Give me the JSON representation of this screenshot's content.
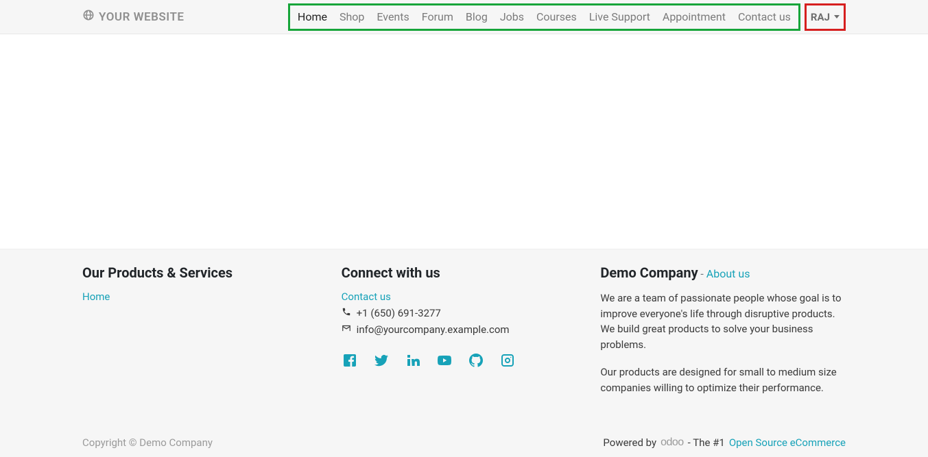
{
  "brand": {
    "name": "YOUR WEBSITE"
  },
  "nav": {
    "items": [
      {
        "label": "Home",
        "active": true
      },
      {
        "label": "Shop"
      },
      {
        "label": "Events"
      },
      {
        "label": "Forum"
      },
      {
        "label": "Blog"
      },
      {
        "label": "Jobs"
      },
      {
        "label": "Courses"
      },
      {
        "label": "Live Support"
      },
      {
        "label": "Appointment"
      },
      {
        "label": "Contact us"
      }
    ]
  },
  "user": {
    "name": "RAJ"
  },
  "footer": {
    "col1": {
      "heading": "Our Products & Services",
      "link": "Home"
    },
    "col2": {
      "heading": "Connect with us",
      "contact_link": "Contact us",
      "phone": "+1 (650) 691-3277",
      "email": "info@yourcompany.example.com"
    },
    "col3": {
      "company": "Demo Company",
      "dash": " - ",
      "about": "About us",
      "desc1": "We are a team of passionate people whose goal is to improve everyone's life through disruptive products. We build great products to solve your business problems.",
      "desc2": "Our products are designed for small to medium size companies willing to optimize their performance."
    },
    "bottom": {
      "copyright": "Copyright © Demo Company",
      "powered_by": "Powered by",
      "odoo": "odoo",
      "the_no1": " - The #1 ",
      "ose": "Open Source eCommerce"
    }
  }
}
